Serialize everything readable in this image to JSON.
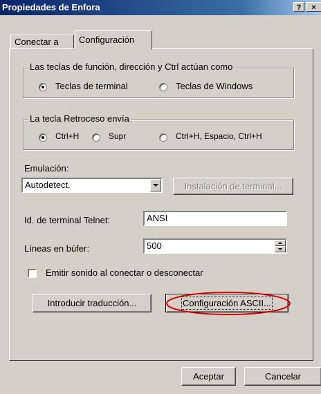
{
  "window": {
    "title": "Propiedades de Enfora",
    "help_button": "?",
    "close_button": "×"
  },
  "tabs": [
    {
      "label": "Conectar a",
      "selected": false
    },
    {
      "label": "Configuración",
      "selected": true
    }
  ],
  "function_keys_group": {
    "legend": "Las teclas de función, dirección y Ctrl actúan como",
    "options": [
      {
        "label": "Teclas de terminal",
        "checked": true
      },
      {
        "label": "Teclas de Windows",
        "checked": false
      }
    ]
  },
  "backspace_group": {
    "legend": "La tecla Retroceso envía",
    "options": [
      {
        "label": "Ctrl+H",
        "checked": true
      },
      {
        "label": "Supr",
        "checked": false
      },
      {
        "label": "Ctrl+H, Espacio, Ctrl+H",
        "checked": false
      }
    ]
  },
  "emulation": {
    "label": "Emulación:",
    "selected": "Autodetect.",
    "terminal_setup_button": "Instalación de terminal..."
  },
  "telnet_id": {
    "label": "Id. de terminal Telnet:",
    "value": "ANSI"
  },
  "buffer_lines": {
    "label": "Líneas en búfer:",
    "value": "500"
  },
  "beep_checkbox": {
    "label": "Emitir sonido al conectar o desconectar",
    "checked": false
  },
  "buttons": {
    "translation": "Introducir traducción...",
    "ascii_setup": "Configuración ASCII...",
    "ok": "Aceptar",
    "cancel": "Cancelar"
  },
  "colors": {
    "title_bar": "#0a246a",
    "face": "#d4d0c8",
    "highlight_annotation": "#e00000"
  }
}
